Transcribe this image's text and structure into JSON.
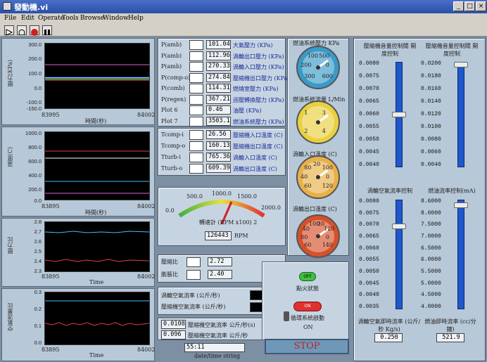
{
  "window": {
    "title": "發動機.vi"
  },
  "menu": [
    "File",
    "Edit",
    "Operate",
    "Tools",
    "Browse",
    "Window",
    "Help"
  ],
  "plots": [
    {
      "ylabel": "壓力(KPa)",
      "xlabel": "時間(秒)",
      "xmin": "83995",
      "xmax": "84002",
      "ticks": [
        "300.0",
        "200.0",
        "100.0",
        "0.0",
        "-100.0",
        "-150.0"
      ]
    },
    {
      "ylabel": "溫度(C)",
      "xlabel": "時間(秒)",
      "xmin": "83895",
      "xmax": "84002",
      "ticks": [
        "1000.0",
        "800.0",
        "600.0",
        "400.0",
        "200.0",
        "0.0"
      ]
    },
    {
      "ylabel": "壓力比",
      "xlabel": "Time",
      "xmin": "83895",
      "xmax": "84002",
      "ticks": [
        "2.8",
        "2.7",
        "2.6",
        "2.5",
        "2.4",
        "2.3"
      ]
    },
    {
      "ylabel": "空氣流量比",
      "xlabel": "Time",
      "xmin": "83895",
      "xmax": "84002",
      "ticks": [
        "0.3",
        "0.2",
        "0.1",
        "0.0"
      ]
    }
  ],
  "pressures": [
    {
      "tag": "P(amb)",
      "value": "101.04",
      "label": "大氣壓力 (KPa)"
    },
    {
      "tag": "P(amb)",
      "value": "112.96",
      "label": "渦輪出口壓力 (KPa)"
    },
    {
      "tag": "P(amb)",
      "value": "270.33",
      "label": "渦輪入口壓力 (KPa)"
    },
    {
      "tag": "P(comp-o)",
      "value": "274.84",
      "label": "壓縮機出口壓力 (KPa)"
    },
    {
      "tag": "P(comb)",
      "value": "114.31",
      "label": "燃燒室壓力 (KPa)"
    },
    {
      "tag": "P(regen)",
      "value": "367.21",
      "label": "迴壓轉換壓力 (KPa)"
    },
    {
      "tag": "Plot 6",
      "value": "0.46",
      "label": "油壓 (KPa)"
    },
    {
      "tag": "Plot 7",
      "value": "3503.1",
      "label": "燃油系統壓力 (KPa)"
    }
  ],
  "temps": [
    {
      "tag": "Tcomp-i",
      "value": "26.56",
      "label": "壓縮機入口溫度 (C)"
    },
    {
      "tag": "Tcomp-o",
      "value": "160.13",
      "label": "壓縮機出口溫度 (C)"
    },
    {
      "tag": "Tturb-i",
      "value": "765.36",
      "label": "渦輪入口溫度 (C)"
    },
    {
      "tag": "Tturb-o",
      "value": "609.39",
      "label": "渦輪出口溫度 (C)"
    }
  ],
  "rpm": {
    "label": "轉速計 (RPM x100) 2",
    "value": "126443",
    "unit": "RPM",
    "ticks": [
      "0.0",
      "500.0",
      "1000.0",
      "1500.0",
      "2000.0"
    ],
    "fraction": 0.63
  },
  "ratios": [
    {
      "label": "壓縮比",
      "value": "2.72"
    },
    {
      "label": "膨脹比",
      "value": "2.40"
    }
  ],
  "flow_legend": [
    "渦輪空氣流率 (公斤/秒)",
    "壓縮機空氣流率 (公斤/秒)"
  ],
  "flows": [
    {
      "value": "0.0108",
      "label": "壓縮機空氣流率 公斤/秒(s)"
    },
    {
      "value": "0.096",
      "label": "壓縮機空氣流率 公斤/秒"
    }
  ],
  "datetime": {
    "value": "55:11",
    "label": "date/time string"
  },
  "gauges": [
    {
      "title": "燃油系統壓力 KPa",
      "ticks": [
        "300",
        "200",
        "100",
        "500",
        "0",
        "600"
      ],
      "color": "#3a9ac8"
    },
    {
      "title": "燃油系統流量 L/Min",
      "ticks": [
        "2",
        "1",
        "3",
        "4"
      ],
      "color": "#e8d040"
    },
    {
      "title": "渦輪入口溫度 (C)",
      "ticks": [
        "60",
        "40",
        "80",
        "20",
        "100",
        "0",
        "120"
      ],
      "color": "#e8b048"
    },
    {
      "title": "渦輪出口溫度 (C)",
      "ticks": [
        "60",
        "80",
        "40",
        "100",
        "20",
        "120",
        "0",
        "140"
      ],
      "color": "#d8502a"
    }
  ],
  "status": {
    "ignition_label": "點火狀態",
    "ignition_btn": "OFF",
    "starter_label": "循環系統啟動",
    "starter_btn": "ON",
    "on": "ON",
    "stop": "STOP"
  },
  "sliders": [
    {
      "title": "壓縮機音量控制閥 開度控制",
      "ticks": [
        "0.0080",
        "0.0075",
        "0.0070",
        "0.0065",
        "0.0060",
        "0.0055",
        "0.0050",
        "0.0045",
        "0.0040"
      ],
      "level": 0.5
    },
    {
      "title": "壓縮機音量控制閥 開度控制",
      "ticks": [
        "0.0200",
        "0.0180",
        "0.0160",
        "0.0140",
        "0.0120",
        "0.0100",
        "0.0080",
        "0.0060",
        "0.0040"
      ],
      "level": 1.0
    },
    {
      "title": "渦輪空氣流率控制",
      "ticks": [
        "0.0080",
        "0.0075",
        "0.0070",
        "0.0065",
        "0.0060",
        "0.0055",
        "0.0050",
        "0.0045",
        "0.0040",
        "0.0035"
      ],
      "level": 0.77
    },
    {
      "title": "燃油流率控制(mA)",
      "ticks": [
        "8.6000",
        "8.0000",
        "7.5000",
        "7.0000",
        "6.5000",
        "6.0000",
        "5.5000",
        "5.0000",
        "4.5000",
        "4.0000"
      ],
      "level": 0.97
    }
  ],
  "slider_readouts": [
    {
      "label": "渦輪空氣即時流率 (公斤/秒 Kg/s)",
      "value": "0.250"
    },
    {
      "label": "燃油即時流率 (cc/分鐘)",
      "value": "521.9"
    }
  ]
}
